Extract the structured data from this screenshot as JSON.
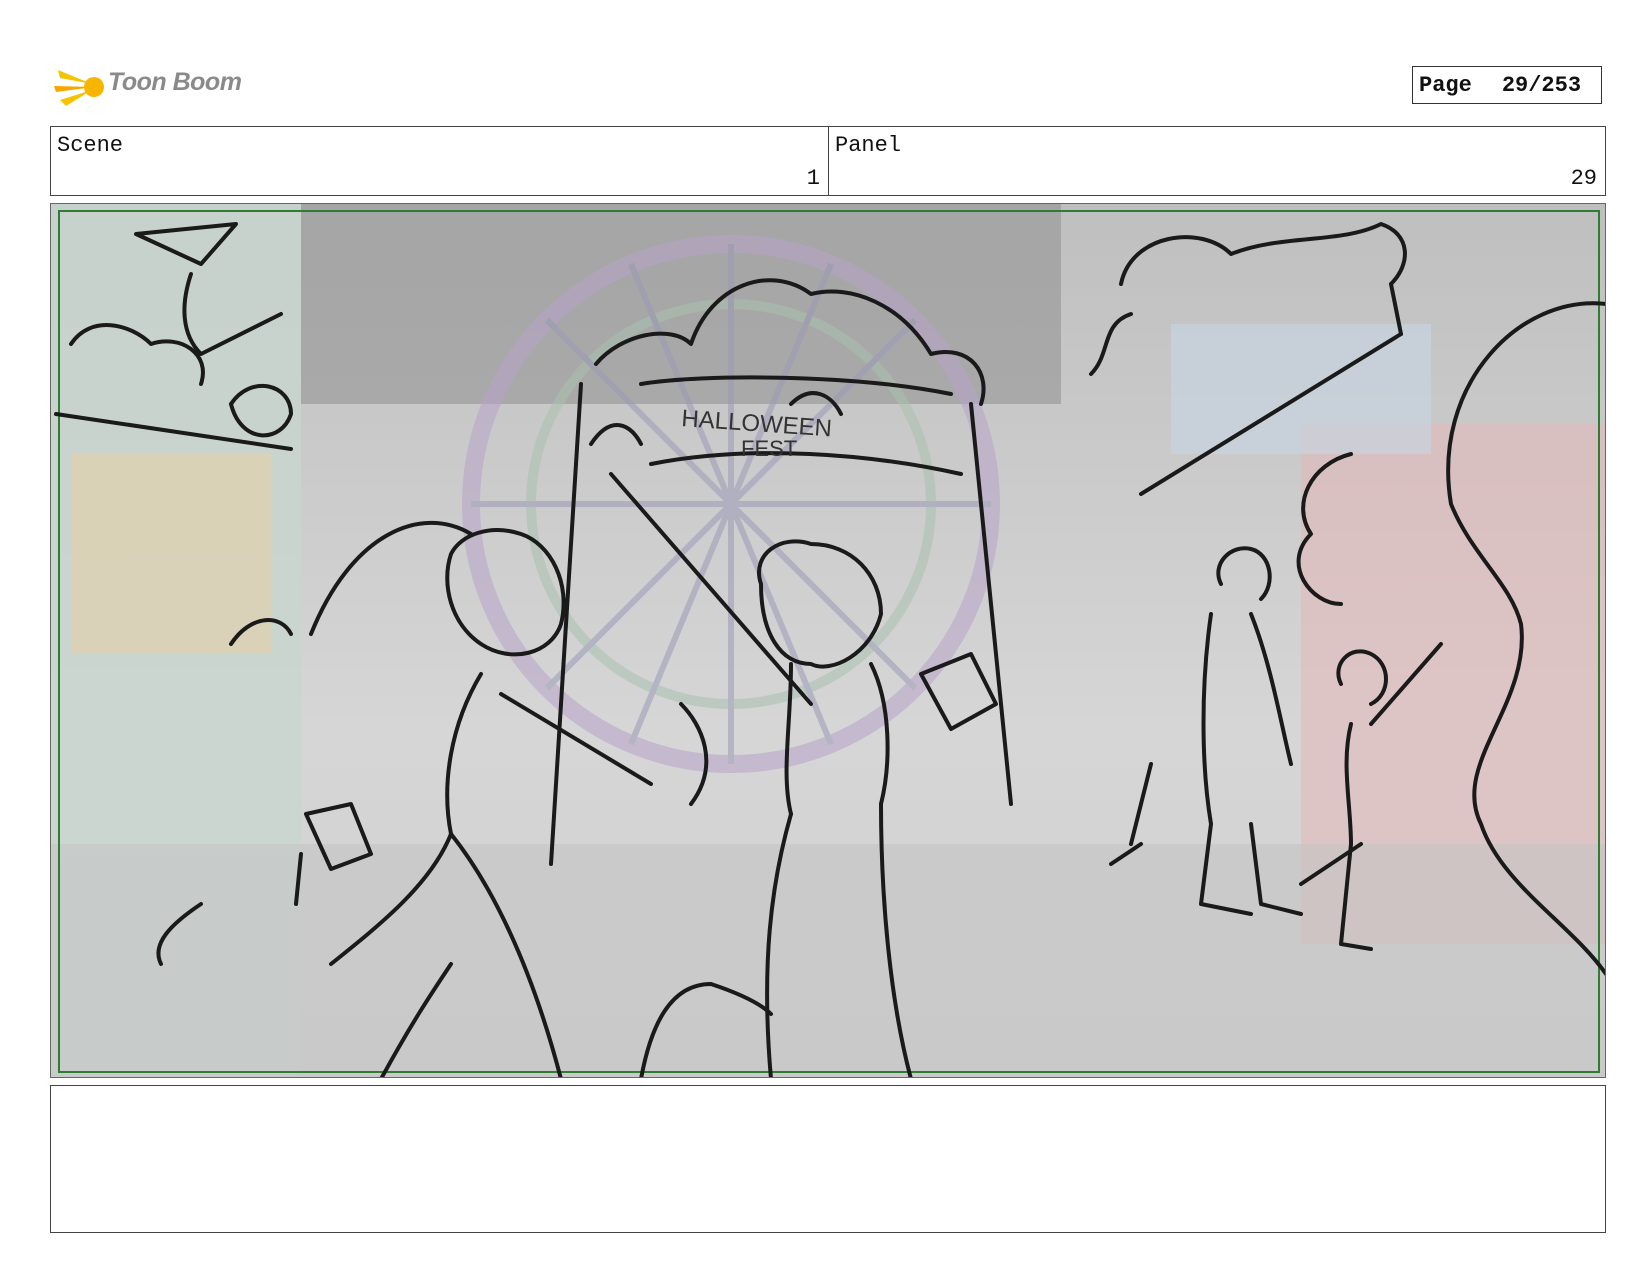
{
  "header": {
    "logo_text": "Toon Boom",
    "page_label": "Page",
    "page_number": "29/253"
  },
  "info": {
    "scene_label": "Scene",
    "scene_value": "1",
    "panel_label": "Panel",
    "panel_value": "29"
  },
  "artwork": {
    "banner_text": "HALLOWEEN",
    "banner_text_2": "FEST",
    "colors": {
      "safe_frame": "#2e7d32",
      "sketch_line": "#1a1a1a",
      "background_tint": "#d8d8d8"
    }
  },
  "notes": {
    "text": ""
  }
}
